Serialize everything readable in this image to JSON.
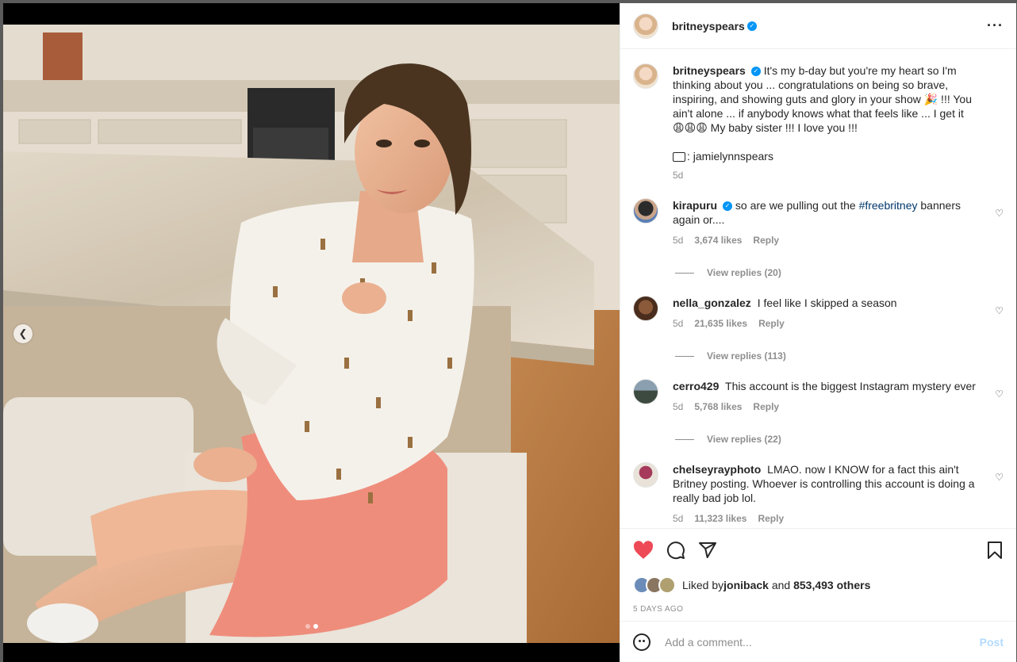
{
  "post": {
    "author": "britneyspears",
    "caption_text": "It's my b-day but you're my heart so I'm thinking about you ... congratulations on being so brave, inspiring, and showing guts and glory in your show 🎉 !!! You ain't alone ... if anybody knows what that feels like ... I get it 😩😩😩 My baby sister !!! I love you !!!",
    "photo_credit": ": jamielynnspears",
    "caption_age": "5d",
    "carousel_total": 2,
    "carousel_current": 2
  },
  "comments": [
    {
      "username": "kirapuru",
      "verified": true,
      "text_before": "so are we pulling out the ",
      "hashtag": "#freebritney",
      "text_after": " banners again or....",
      "age": "5d",
      "likes": "3,674 likes",
      "reply_label": "Reply",
      "view_replies": "View replies (20)"
    },
    {
      "username": "nella_gonzalez",
      "text": "I feel like I skipped a season",
      "age": "5d",
      "likes": "21,635 likes",
      "reply_label": "Reply",
      "view_replies": "View replies (113)"
    },
    {
      "username": "cerro429",
      "text": "This account is the biggest Instagram mystery ever",
      "age": "5d",
      "likes": "5,768 likes",
      "reply_label": "Reply",
      "view_replies": "View replies (22)"
    },
    {
      "username": "chelseyrayphoto",
      "text": "LMAO. now I KNOW for a fact this ain't Britney posting. Whoever is controlling this account is doing a really bad job lol.",
      "age": "5d",
      "likes": "11,323 likes",
      "reply_label": "Reply"
    }
  ],
  "likes": {
    "prefix": "Liked by ",
    "first_liker": "joniback",
    "middle": " and ",
    "others": "853,493 others"
  },
  "post_time": "5 DAYS AGO",
  "add_comment": {
    "placeholder": "Add a comment...",
    "post_label": "Post"
  },
  "icons": {
    "verified": "verified-badge-icon",
    "more": "more-options-icon",
    "like": "heart-icon",
    "comment": "comment-icon",
    "share": "share-icon",
    "save": "bookmark-icon",
    "emoji": "emoji-icon",
    "prev": "chevron-left-icon"
  },
  "colors": {
    "like_active": "#ed4956",
    "verified": "#0095f6",
    "hashtag": "#00376b",
    "post_disabled": "#b3dbff"
  }
}
